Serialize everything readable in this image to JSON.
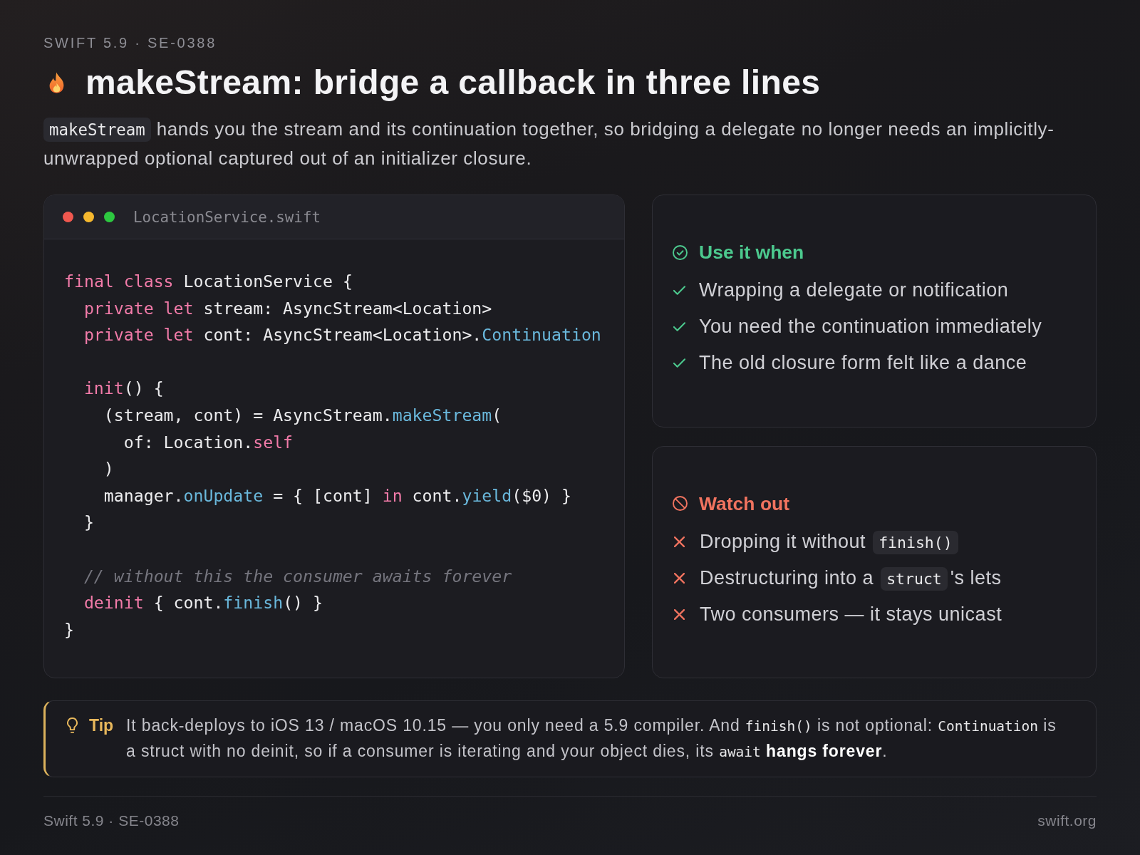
{
  "eyebrow": "SWIFT 5.9 · SE-0388",
  "title": "makeStream: bridge a callback in three lines",
  "intro": [
    {
      "kind": "code",
      "text": "makeStream"
    },
    {
      "kind": "text",
      "text": " hands you the stream and its continuation together, so bridging a delegate no longer needs an implicitly-unwrapped optional captured out of an initializer closure."
    }
  ],
  "code_panel": {
    "filename": "LocationService.swift",
    "lines": [
      {
        "kind": "code",
        "tokens": [
          {
            "kind": "keyword",
            "text": "final class"
          },
          {
            "kind": "plain",
            "text": " LocationService {"
          }
        ],
        "children": [
          {
            "kind": "code",
            "tokens": [
              {
                "kind": "keyword",
                "text": "private let"
              },
              {
                "kind": "plain",
                "text": " stream: AsyncStream<Location>"
              }
            ]
          },
          {
            "kind": "code",
            "tokens": [
              {
                "kind": "keyword",
                "text": "private let"
              },
              {
                "kind": "plain",
                "text": " cont: AsyncStream<Location>."
              },
              {
                "kind": "member",
                "text": "Continuation"
              }
            ]
          },
          {
            "kind": "blank"
          },
          {
            "kind": "code",
            "tokens": [
              {
                "kind": "keyword",
                "text": "init"
              },
              {
                "kind": "plain",
                "text": "() {"
              }
            ],
            "children": [
              {
                "kind": "code",
                "tokens": [
                  {
                    "kind": "plain",
                    "text": "(stream, cont) = AsyncStream."
                  },
                  {
                    "kind": "member",
                    "text": "makeStream"
                  },
                  {
                    "kind": "plain",
                    "text": "("
                  }
                ],
                "children": [
                  {
                    "kind": "code",
                    "tokens": [
                      {
                        "kind": "plain",
                        "text": "of: Location."
                      },
                      {
                        "kind": "keyword",
                        "text": "self"
                      }
                    ]
                  }
                ]
              },
              {
                "kind": "code",
                "tokens": [
                  {
                    "kind": "plain",
                    "text": ")"
                  }
                ]
              },
              {
                "kind": "code",
                "tokens": [
                  {
                    "kind": "plain",
                    "text": "manager."
                  },
                  {
                    "kind": "member",
                    "text": "onUpdate"
                  },
                  {
                    "kind": "plain",
                    "text": " = { [cont] "
                  },
                  {
                    "kind": "keyword",
                    "text": "in"
                  },
                  {
                    "kind": "plain",
                    "text": " cont."
                  },
                  {
                    "kind": "member",
                    "text": "yield"
                  },
                  {
                    "kind": "plain",
                    "text": "($0) }"
                  }
                ]
              }
            ]
          },
          {
            "kind": "code",
            "tokens": [
              {
                "kind": "plain",
                "text": "}"
              }
            ]
          },
          {
            "kind": "blank"
          },
          {
            "kind": "code",
            "tokens": [
              {
                "kind": "comment",
                "text": "// without this the consumer awaits forever"
              }
            ]
          },
          {
            "kind": "code",
            "tokens": [
              {
                "kind": "keyword",
                "text": "deinit"
              },
              {
                "kind": "plain",
                "text": " { cont."
              },
              {
                "kind": "member",
                "text": "finish"
              },
              {
                "kind": "plain",
                "text": "() }"
              }
            ]
          }
        ]
      },
      {
        "kind": "code",
        "tokens": [
          {
            "kind": "plain",
            "text": "}"
          }
        ]
      }
    ]
  },
  "cards": [
    {
      "kind": "do",
      "title": "Use it when",
      "items": [
        [
          {
            "kind": "text",
            "text": "Wrapping a delegate or notification"
          }
        ],
        [
          {
            "kind": "text",
            "text": "You need the continuation immediately"
          }
        ],
        [
          {
            "kind": "text",
            "text": "The old closure form felt like a dance"
          }
        ]
      ]
    },
    {
      "kind": "dont",
      "title": "Watch out",
      "items": [
        [
          {
            "kind": "text",
            "text": "Dropping it without "
          },
          {
            "kind": "code",
            "text": "finish()"
          }
        ],
        [
          {
            "kind": "text",
            "text": "Destructuring into a "
          },
          {
            "kind": "code",
            "text": "struct"
          },
          {
            "kind": "text",
            "text": "'s lets"
          }
        ],
        [
          {
            "kind": "text",
            "text": "Two consumers — it stays unicast"
          }
        ]
      ]
    }
  ],
  "tip": {
    "label": "Tip",
    "segments": [
      {
        "kind": "text",
        "text": "It back-deploys to iOS 13 / macOS 10.15 — you only need a 5.9 compiler. And "
      },
      {
        "kind": "code",
        "text": "finish()"
      },
      {
        "kind": "text",
        "text": " is not optional: "
      },
      {
        "kind": "code",
        "text": "Continuation"
      },
      {
        "kind": "text",
        "text": " is a struct with no deinit, so if a consumer is iterating and your object dies, its "
      },
      {
        "kind": "code",
        "text": "await"
      },
      {
        "kind": "text",
        "text": " **hangs forever**."
      }
    ]
  },
  "footer": {
    "left": "Swift 5.9 · SE-0388",
    "right": "swift.org"
  }
}
